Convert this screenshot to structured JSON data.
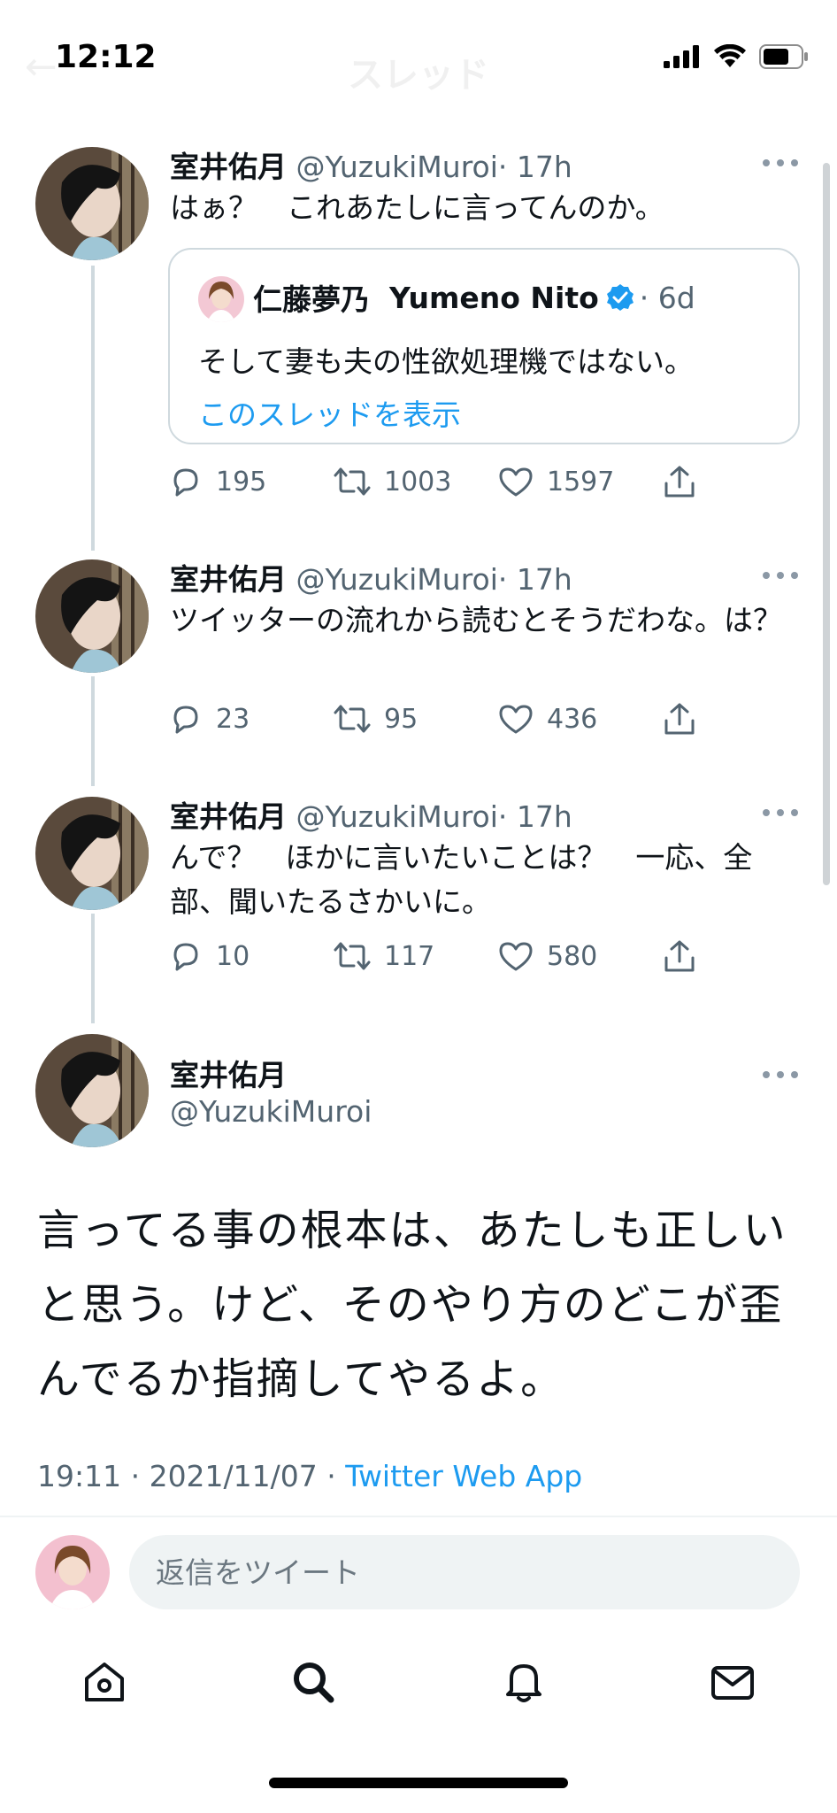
{
  "status_bar": {
    "time": "12:12"
  },
  "header": {
    "title": "スレッド"
  },
  "tweets": [
    {
      "name": "室井佑月",
      "handle": "@YuzukiMuroi",
      "time": "· 17h",
      "text": "はぁ？　これあたしに言ってんのか。",
      "quote": {
        "name": "仁藤夢乃",
        "display_name": "Yumeno Nito",
        "time": "· 6d",
        "text": "そして妻も夫の性欲処理機ではない。",
        "link": "このスレッドを表示"
      },
      "replies": "195",
      "retweets": "1003",
      "likes": "1597"
    },
    {
      "name": "室井佑月",
      "handle": "@YuzukiMuroi",
      "time": "· 17h",
      "text": "ツイッターの流れから読むとそうだわな。は？",
      "replies": "23",
      "retweets": "95",
      "likes": "436"
    },
    {
      "name": "室井佑月",
      "handle": "@YuzukiMuroi",
      "time": "· 17h",
      "text": "んで？　ほかに言いたいことは？　一応、全部、聞いたるさかいに。",
      "replies": "10",
      "retweets": "117",
      "likes": "580"
    }
  ],
  "main_tweet": {
    "name": "室井佑月",
    "handle": "@YuzukiMuroi",
    "text": "言ってる事の根本は、あたしも正しいと思う。けど、そのやり方のどこが歪んでるか指摘してやるよ。",
    "timestamp": "19:11 · 2021/11/07 · ",
    "client": "Twitter Web App"
  },
  "reply_box": {
    "placeholder": "返信をツイート"
  },
  "tabs": [
    "home-icon",
    "search-icon",
    "notifications-icon",
    "messages-icon"
  ],
  "colors": {
    "accent": "#1d9bf0",
    "secondary_text": "#536471",
    "border": "#cfd9de"
  }
}
